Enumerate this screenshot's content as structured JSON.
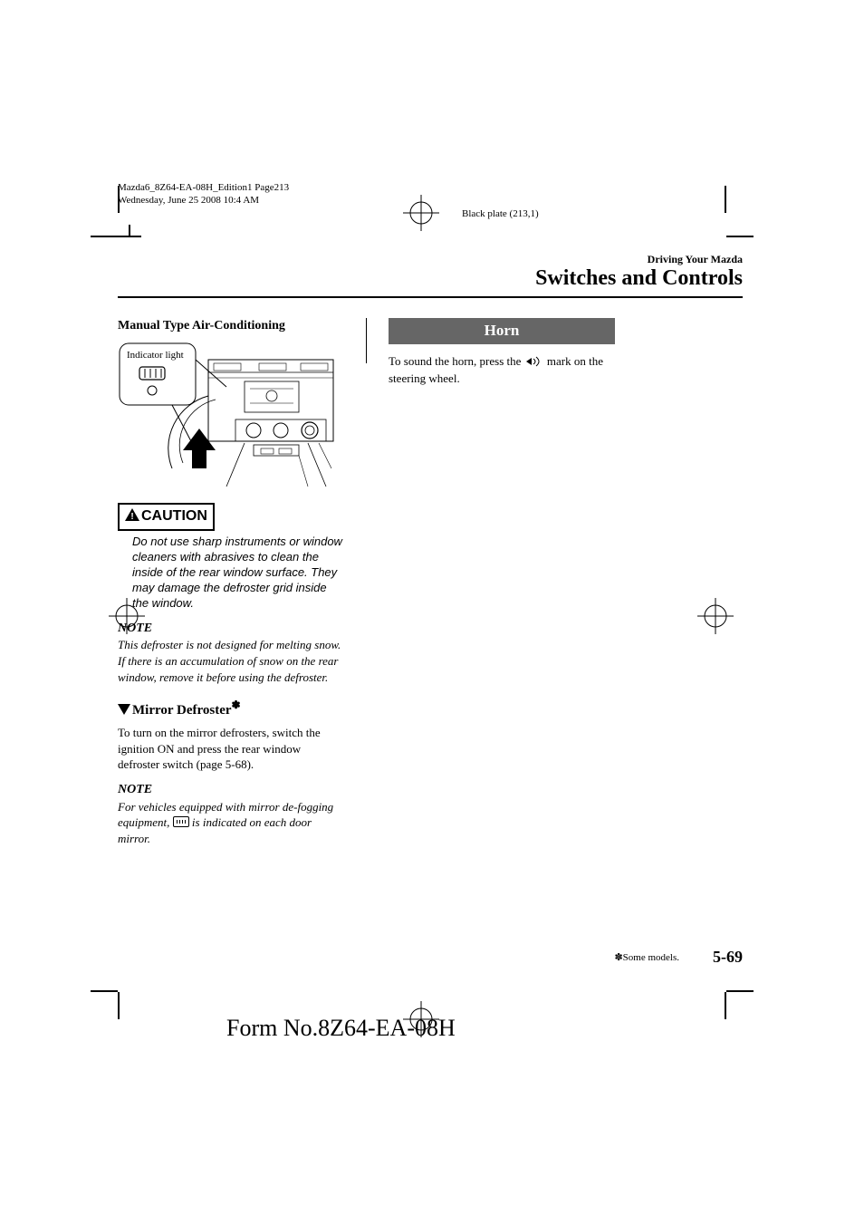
{
  "meta": {
    "doc_id": "Mazda6_8Z64-EA-08H_Edition1 Page213",
    "date_line": "Wednesday, June 25 2008 10:4 AM",
    "black_plate": "Black plate (213,1)"
  },
  "header": {
    "small": "Driving Your Mazda",
    "large": "Switches and Controls"
  },
  "left": {
    "heading": "Manual Type Air-Conditioning",
    "illus_label": "Indicator light",
    "caution_label": "CAUTION",
    "caution_text": "Do not use sharp instruments or window cleaners with abrasives to clean the inside of the rear window surface. They may damage the defroster grid inside the window.",
    "note1_head": "NOTE",
    "note1_body": "This defroster is not designed for melting snow. If there is an accumulation of snow on the rear window, remove it before using the defroster.",
    "mirror_heading": "Mirror Defroster",
    "mirror_body": "To turn on the mirror defrosters, switch the ignition ON and press the rear window defroster switch (page 5-68).",
    "note2_head": "NOTE",
    "note2_body_a": "For vehicles equipped with mirror de-fogging equipment, ",
    "note2_body_b": " is indicated on each door mirror."
  },
  "right": {
    "horn_title": "Horn",
    "horn_body_a": "To sound the horn, press the ",
    "horn_body_b": " mark on the steering wheel."
  },
  "footer": {
    "some_models": "Some models.",
    "page_num": "5-69",
    "form_no": "Form No.8Z64-EA-08H"
  }
}
